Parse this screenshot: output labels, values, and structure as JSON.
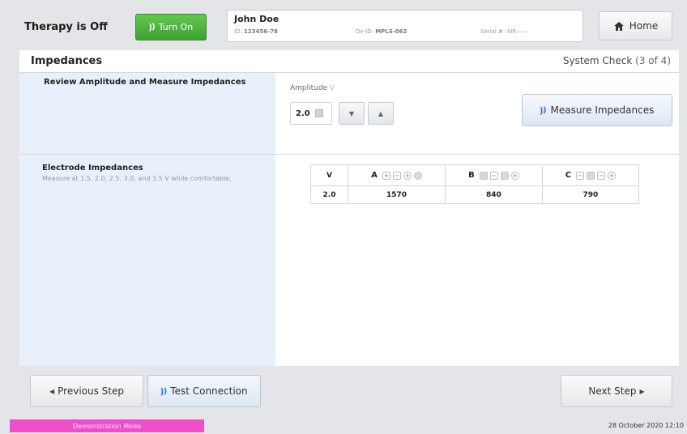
{
  "header": {
    "therapy_status": "Therapy is Off",
    "turn_on_label": "Turn On",
    "patient": {
      "name": "John Doe",
      "id_label": "ID:",
      "id_value": "123456-78",
      "deid_label": "De-ID:",
      "deid_value": "MPLS-062",
      "serial_label": "Serial #:",
      "serial_value": "AIR——"
    },
    "home_label": "Home"
  },
  "page": {
    "title": "Impedances",
    "system_check_label": "System Check",
    "step_count": "(3 of 4)"
  },
  "amplitude_section": {
    "title": "Review Amplitude and Measure Impedances",
    "amplitude_label": "Amplitude",
    "amplitude_unit": "V",
    "amplitude_value": "2.0",
    "down_symbol": "▼",
    "up_symbol": "▲",
    "measure_label": "Measure Impedances"
  },
  "electrode_section": {
    "title": "Electrode Impedances",
    "description": "Measure at 1.5, 2.0, 2.5, 3.0, and 3.5 V while comfortable.",
    "table": {
      "headers": [
        "V",
        "A",
        "B",
        "C"
      ],
      "rows": [
        [
          "2.0",
          "1570",
          "840",
          "790"
        ]
      ]
    }
  },
  "footer": {
    "previous_label": "Previous Step",
    "test_label": "Test Connection",
    "next_label": "Next Step",
    "demo_mode": "Demonstration Mode",
    "datetime": "28 October 2020 12:10"
  },
  "colors": {
    "turn_on_green": "#4fb33f",
    "accent_blue": "#2a72d2",
    "left_panel_blue": "#e8f1fb",
    "demo_pink": "#ee4fc9"
  }
}
